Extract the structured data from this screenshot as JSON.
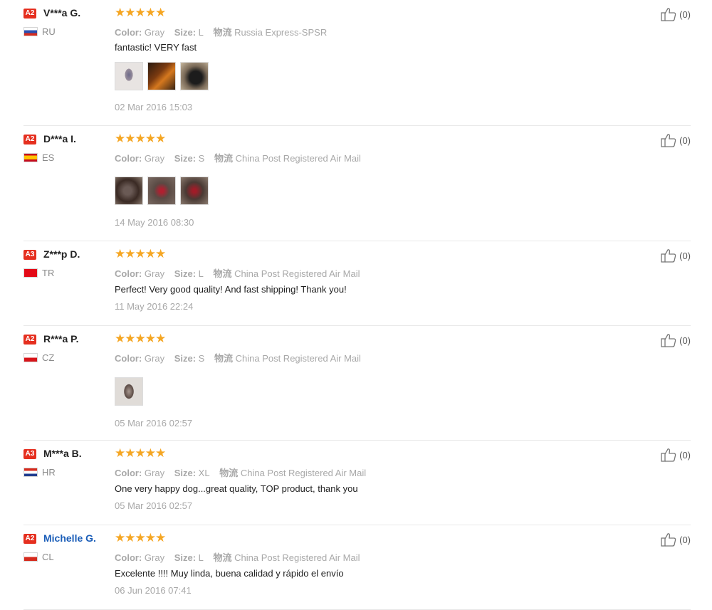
{
  "labels": {
    "color": "Color:",
    "size": "Size:",
    "logistics": "物流"
  },
  "reviews": [
    {
      "level": "A2",
      "name": "V***a G.",
      "country": "RU",
      "color": "Gray",
      "size": "L",
      "shipping": "Russia Express-SPSR",
      "text": "fantastic! VERY fast",
      "date": "02 Mar 2016 15:03",
      "likes": "(0)",
      "thumb_count": 3
    },
    {
      "level": "A2",
      "name": "D***a I.",
      "country": "ES",
      "color": "Gray",
      "size": "S",
      "shipping": "China Post Registered Air Mail",
      "text": "",
      "date": "14 May 2016 08:30",
      "likes": "(0)",
      "thumb_count": 3
    },
    {
      "level": "A3",
      "name": "Z***p D.",
      "country": "TR",
      "color": "Gray",
      "size": "L",
      "shipping": "China Post Registered Air Mail",
      "text": "Perfect! Very good quality! And fast shipping! Thank you!",
      "date": "11 May 2016 22:24",
      "likes": "(0)",
      "thumb_count": 0
    },
    {
      "level": "A2",
      "name": "R***a P.",
      "country": "CZ",
      "color": "Gray",
      "size": "S",
      "shipping": "China Post Registered Air Mail",
      "text": "",
      "date": "05 Mar 2016 02:57",
      "likes": "(0)",
      "thumb_count": 1
    },
    {
      "level": "A3",
      "name": "M***a B.",
      "country": "HR",
      "color": "Gray",
      "size": "XL",
      "shipping": "China Post Registered Air Mail",
      "text": "One very happy dog...great quality, TOP product, thank you",
      "date": "05 Mar 2016 02:57",
      "likes": "(0)",
      "thumb_count": 0
    },
    {
      "level": "A2",
      "name": "Michelle G.",
      "country": "CL",
      "color": "Gray",
      "size": "L",
      "shipping": "China Post Registered Air Mail",
      "text": "Excelente !!!! Muy linda, buena calidad y rápido el envío",
      "date": "06 Jun 2016 07:41",
      "likes": "(0)",
      "thumb_count": 0
    }
  ],
  "stars": "★★★★★",
  "accent_star_color": "#f5a623",
  "level_badge_color": "#e52f1f",
  "link_name_color": "#1a5db8"
}
